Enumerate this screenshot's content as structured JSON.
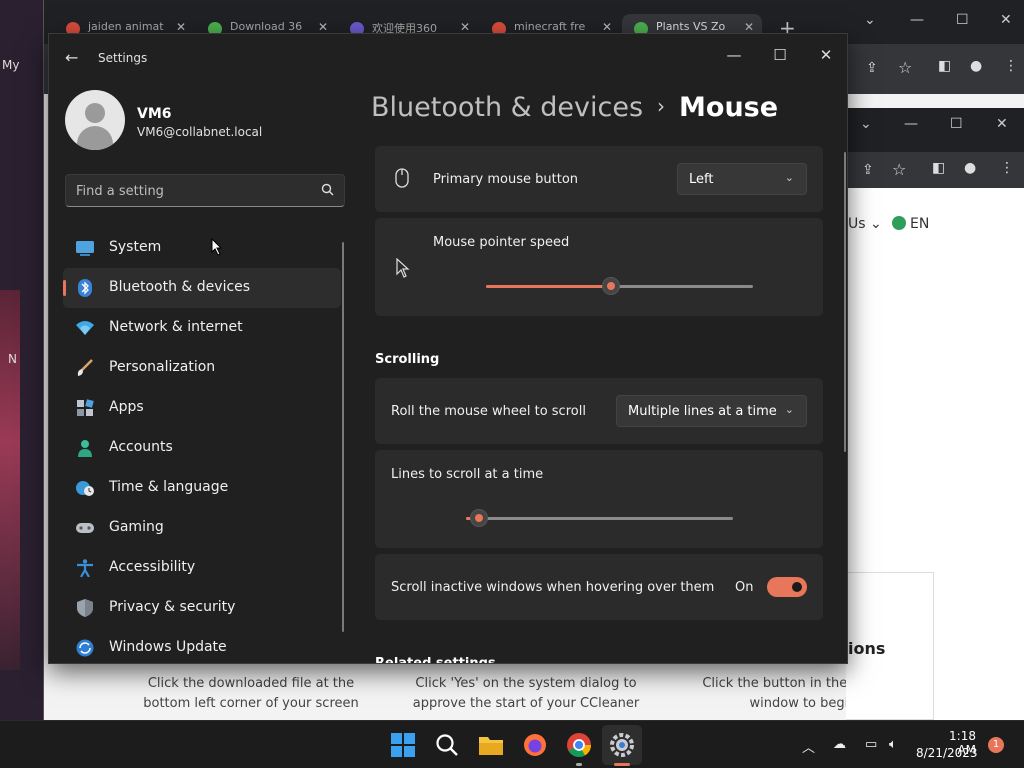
{
  "desktop": {
    "left_labels": [
      "My",
      "N"
    ]
  },
  "browser_back": {
    "tabs": [
      {
        "label": "jaiden animat",
        "color": "#d94c3c"
      },
      {
        "label": "Download 36",
        "color": "#4caf50"
      },
      {
        "label": "欢迎使用360",
        "color": "#6a5acd"
      },
      {
        "label": "minecraft fre",
        "color": "#d94c3c"
      },
      {
        "label": "Plants VS Zo",
        "color": "#4caf50"
      }
    ],
    "steps": [
      "Click the downloaded file at the bottom left corner of your screen",
      "Click 'Yes' on the system dialog to approve the start of your CCleaner",
      "Click the button in the installer window to begin"
    ],
    "partial_heading": "ions"
  },
  "browser_front": {
    "lang_left": "Us",
    "lang_right": "EN"
  },
  "settings": {
    "app_title": "Settings",
    "user": {
      "name": "VM6",
      "email": "VM6@collabnet.local"
    },
    "search": {
      "placeholder": "Find a setting"
    },
    "nav": [
      {
        "label": "System",
        "icon": "monitor-icon",
        "active": false
      },
      {
        "label": "Bluetooth & devices",
        "icon": "bluetooth-icon",
        "active": true
      },
      {
        "label": "Network & internet",
        "icon": "wifi-icon",
        "active": false
      },
      {
        "label": "Personalization",
        "icon": "brush-icon",
        "active": false
      },
      {
        "label": "Apps",
        "icon": "apps-icon",
        "active": false
      },
      {
        "label": "Accounts",
        "icon": "person-icon",
        "active": false
      },
      {
        "label": "Time & language",
        "icon": "globe-clock-icon",
        "active": false
      },
      {
        "label": "Gaming",
        "icon": "gamepad-icon",
        "active": false
      },
      {
        "label": "Accessibility",
        "icon": "accessibility-icon",
        "active": false
      },
      {
        "label": "Privacy & security",
        "icon": "shield-icon",
        "active": false
      },
      {
        "label": "Windows Update",
        "icon": "update-icon",
        "active": false
      }
    ],
    "breadcrumb": {
      "parent": "Bluetooth & devices",
      "separator": "›",
      "current": "Mouse"
    },
    "primary_button": {
      "label": "Primary mouse button",
      "value": "Left"
    },
    "pointer_speed": {
      "label": "Mouse pointer speed",
      "value_fraction": 0.47
    },
    "scrolling_heading": "Scrolling",
    "roll_wheel": {
      "label": "Roll the mouse wheel to scroll",
      "value": "Multiple lines at a time"
    },
    "lines_to_scroll": {
      "label": "Lines to scroll at a time",
      "value_fraction": 0.05
    },
    "inactive_scroll": {
      "label": "Scroll inactive windows when hovering over them",
      "state": "On"
    },
    "related_heading": "Related settings"
  },
  "taskbar": {
    "time": "1:18 AM",
    "date": "8/21/2023",
    "notifications": "1"
  },
  "colors": {
    "accent": "#e8765a",
    "window_bg": "#202020",
    "card_bg": "#2b2b2b"
  }
}
